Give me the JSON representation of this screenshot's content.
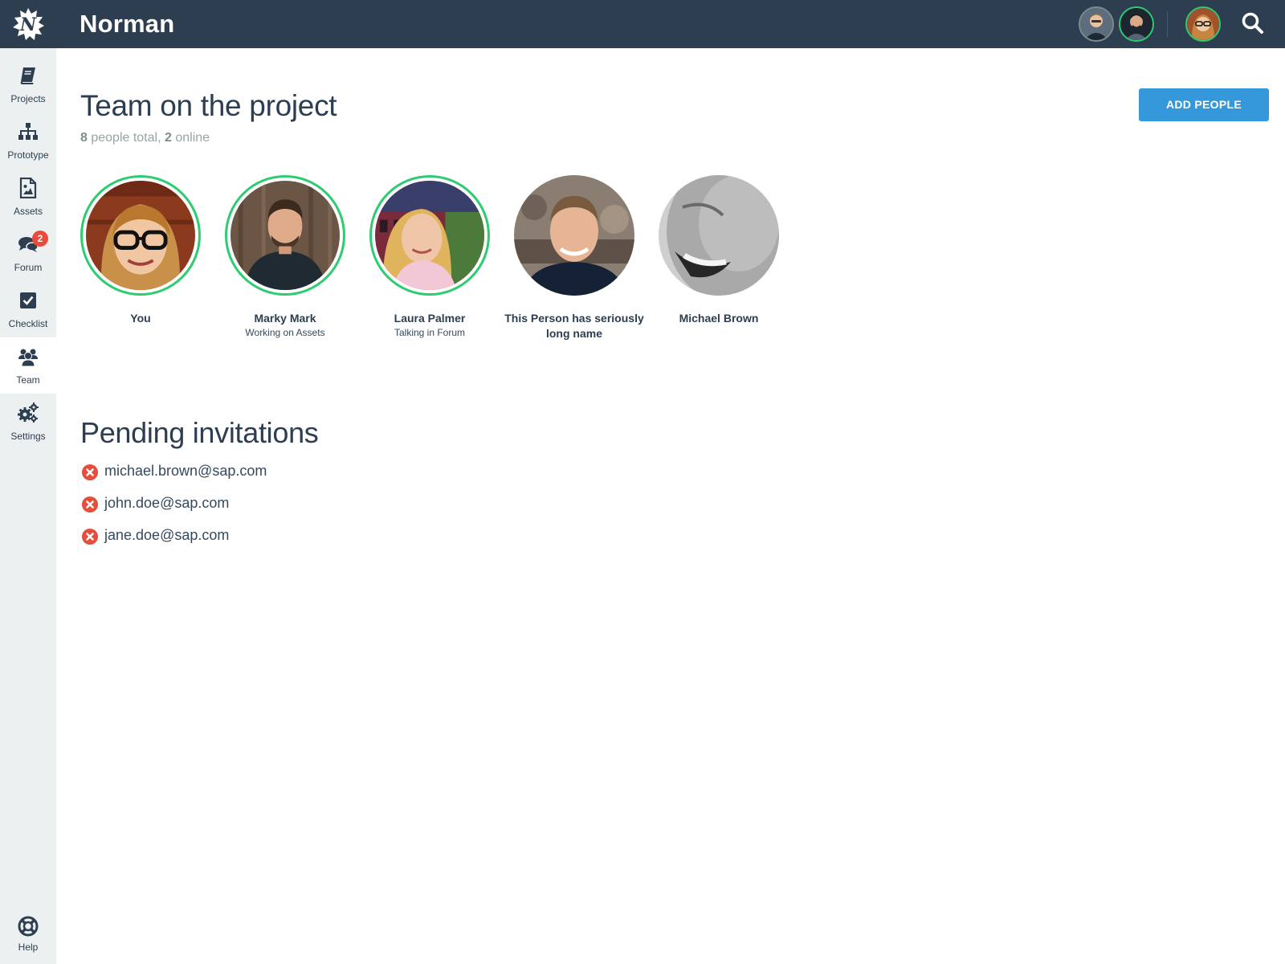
{
  "app": {
    "title": "Norman"
  },
  "colors": {
    "topbar": "#2c3e50",
    "sidebar": "#ecf0f1",
    "accent": "#3498db",
    "online": "#2ecc71",
    "danger": "#e74c3c"
  },
  "header": {
    "collaborators": [
      {
        "icon": "avatar",
        "online": false
      },
      {
        "icon": "avatar",
        "online": true
      }
    ],
    "current_user": {
      "icon": "avatar",
      "online": true
    },
    "search_icon": "search-icon"
  },
  "sidebar": {
    "items": [
      {
        "label": "Projects",
        "icon": "book-icon"
      },
      {
        "label": "Prototype",
        "icon": "sitemap-icon"
      },
      {
        "label": "Assets",
        "icon": "image-file-icon"
      },
      {
        "label": "Forum",
        "icon": "chat-icon",
        "badge": "2"
      },
      {
        "label": "Checklist",
        "icon": "checkbox-icon"
      },
      {
        "label": "Team",
        "icon": "people-icon",
        "active": true
      },
      {
        "label": "Settings",
        "icon": "gears-icon"
      }
    ],
    "help": {
      "label": "Help",
      "icon": "lifebuoy-icon"
    }
  },
  "team": {
    "title": "Team on the project",
    "total_count": "8",
    "total_text": " people total, ",
    "online_count": "2",
    "online_text": " online",
    "add_button": "ADD PEOPLE",
    "members": [
      {
        "name": "You",
        "status": "",
        "online": true
      },
      {
        "name": "Marky Mark",
        "status": "Working on Assets",
        "online": true
      },
      {
        "name": "Laura Palmer",
        "status": "Talking in Forum",
        "online": true
      },
      {
        "name": "This Person has seriously long name",
        "status": "",
        "online": false
      },
      {
        "name": "Michael Brown",
        "status": "",
        "online": false
      }
    ]
  },
  "invitations": {
    "title": "Pending invitations",
    "items": [
      {
        "email": "michael.brown@sap.com"
      },
      {
        "email": "john.doe@sap.com"
      },
      {
        "email": "jane.doe@sap.com"
      }
    ]
  }
}
